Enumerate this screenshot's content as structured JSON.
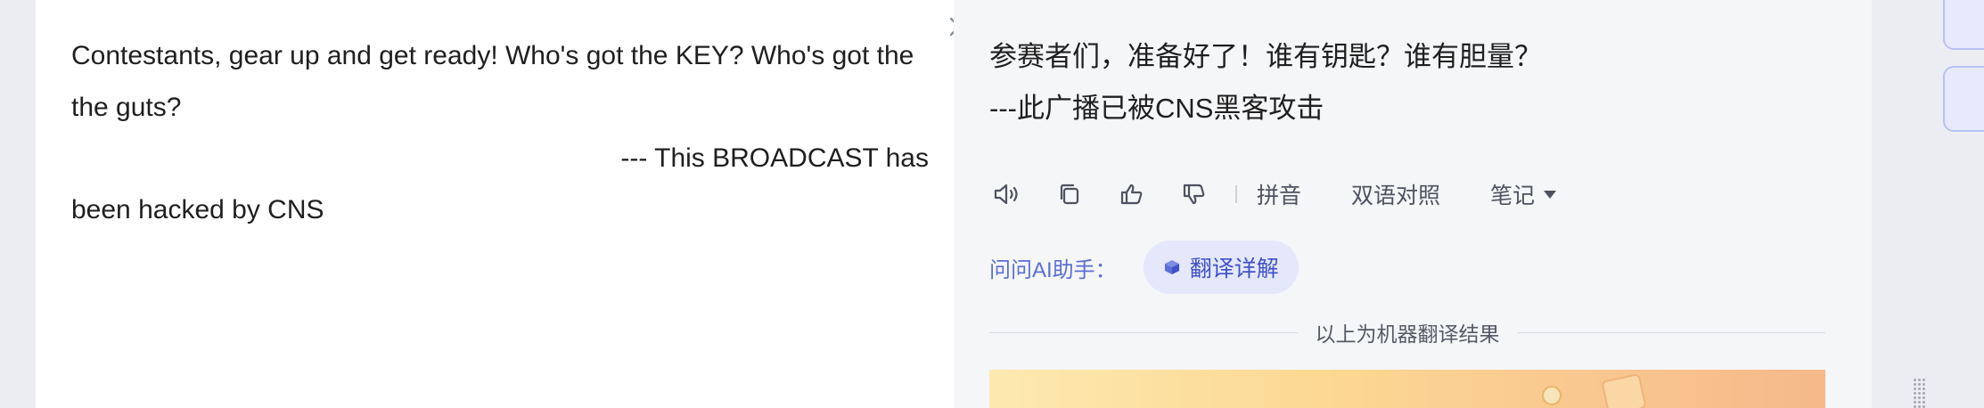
{
  "source": {
    "paragraph_1": "Contestants, gear up and get ready! Who's got the KEY? Who's got the the guts?",
    "paragraph_2_right": "--- This BROADCAST has",
    "paragraph_2_rest": "been hacked by CNS"
  },
  "translation": {
    "line_1": "参赛者们，准备好了！谁有钥匙？谁有胆量？",
    "line_2": "---此广播已被CNS黑客攻击"
  },
  "toolbar": {
    "icons": [
      "speaker-icon",
      "copy-icon",
      "thumbs-up-icon",
      "thumbs-down-icon"
    ],
    "pinyin_label": "拼音",
    "bilingual_label": "双语对照",
    "notes_label": "笔记"
  },
  "ai_assistant": {
    "label": "问问AI助手：",
    "chip_label": "翻译详解"
  },
  "footer": {
    "machine_translation_note": "以上为机器翻译结果"
  },
  "colors": {
    "accent": "#5b6fd6",
    "chip_bg": "#e5e8fb",
    "text": "#1f1f1f"
  }
}
